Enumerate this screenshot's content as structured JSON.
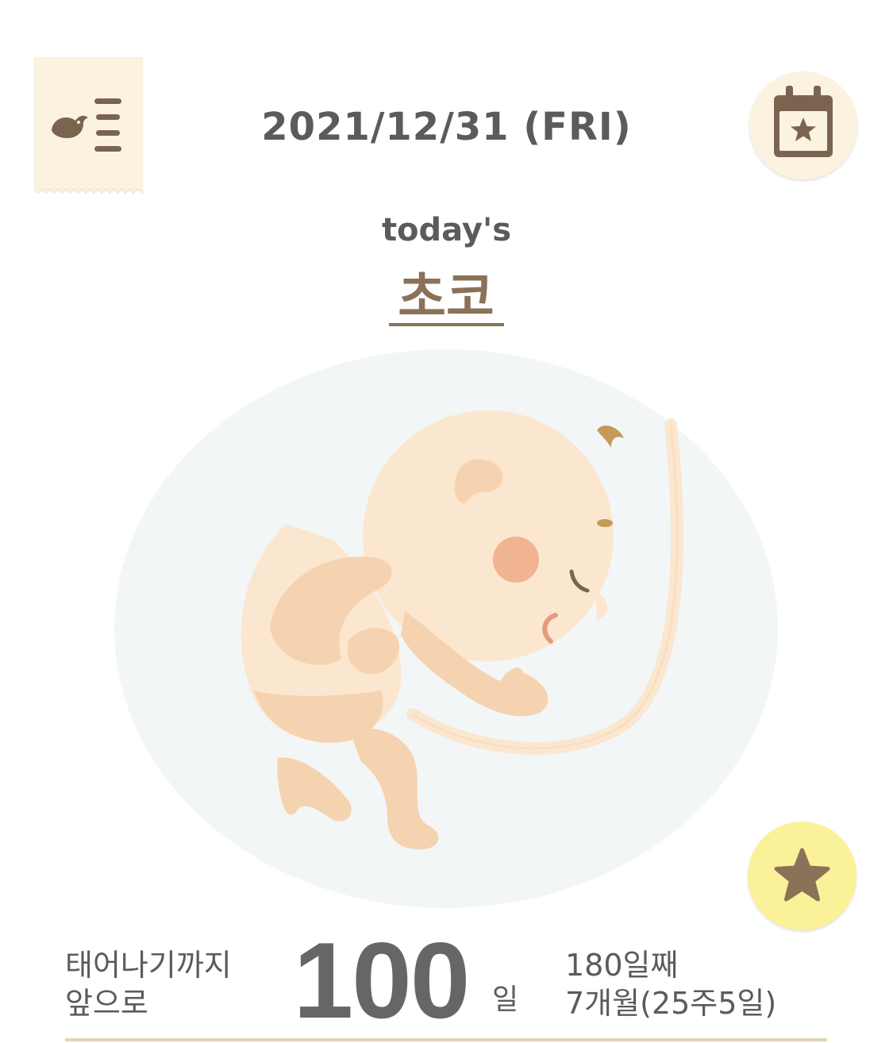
{
  "header": {
    "date": "2021/12/31 (FRI)"
  },
  "hero": {
    "today_label": "today's",
    "baby_name": "초코"
  },
  "countdown": {
    "label_line1": "태어나기까지",
    "label_line2": "앞으로",
    "days_left": "100",
    "days_unit": "일",
    "day_count": "180일째",
    "age": "7개월(25주5일)"
  },
  "colors": {
    "accent_brown": "#8a7258",
    "text_gray": "#5b5b5b",
    "cream": "#fbf3df",
    "star_yellow": "#fbf199"
  },
  "icons": {
    "menu": "bird-menu-icon",
    "calendar": "calendar-star-icon",
    "favorite": "star-icon"
  }
}
